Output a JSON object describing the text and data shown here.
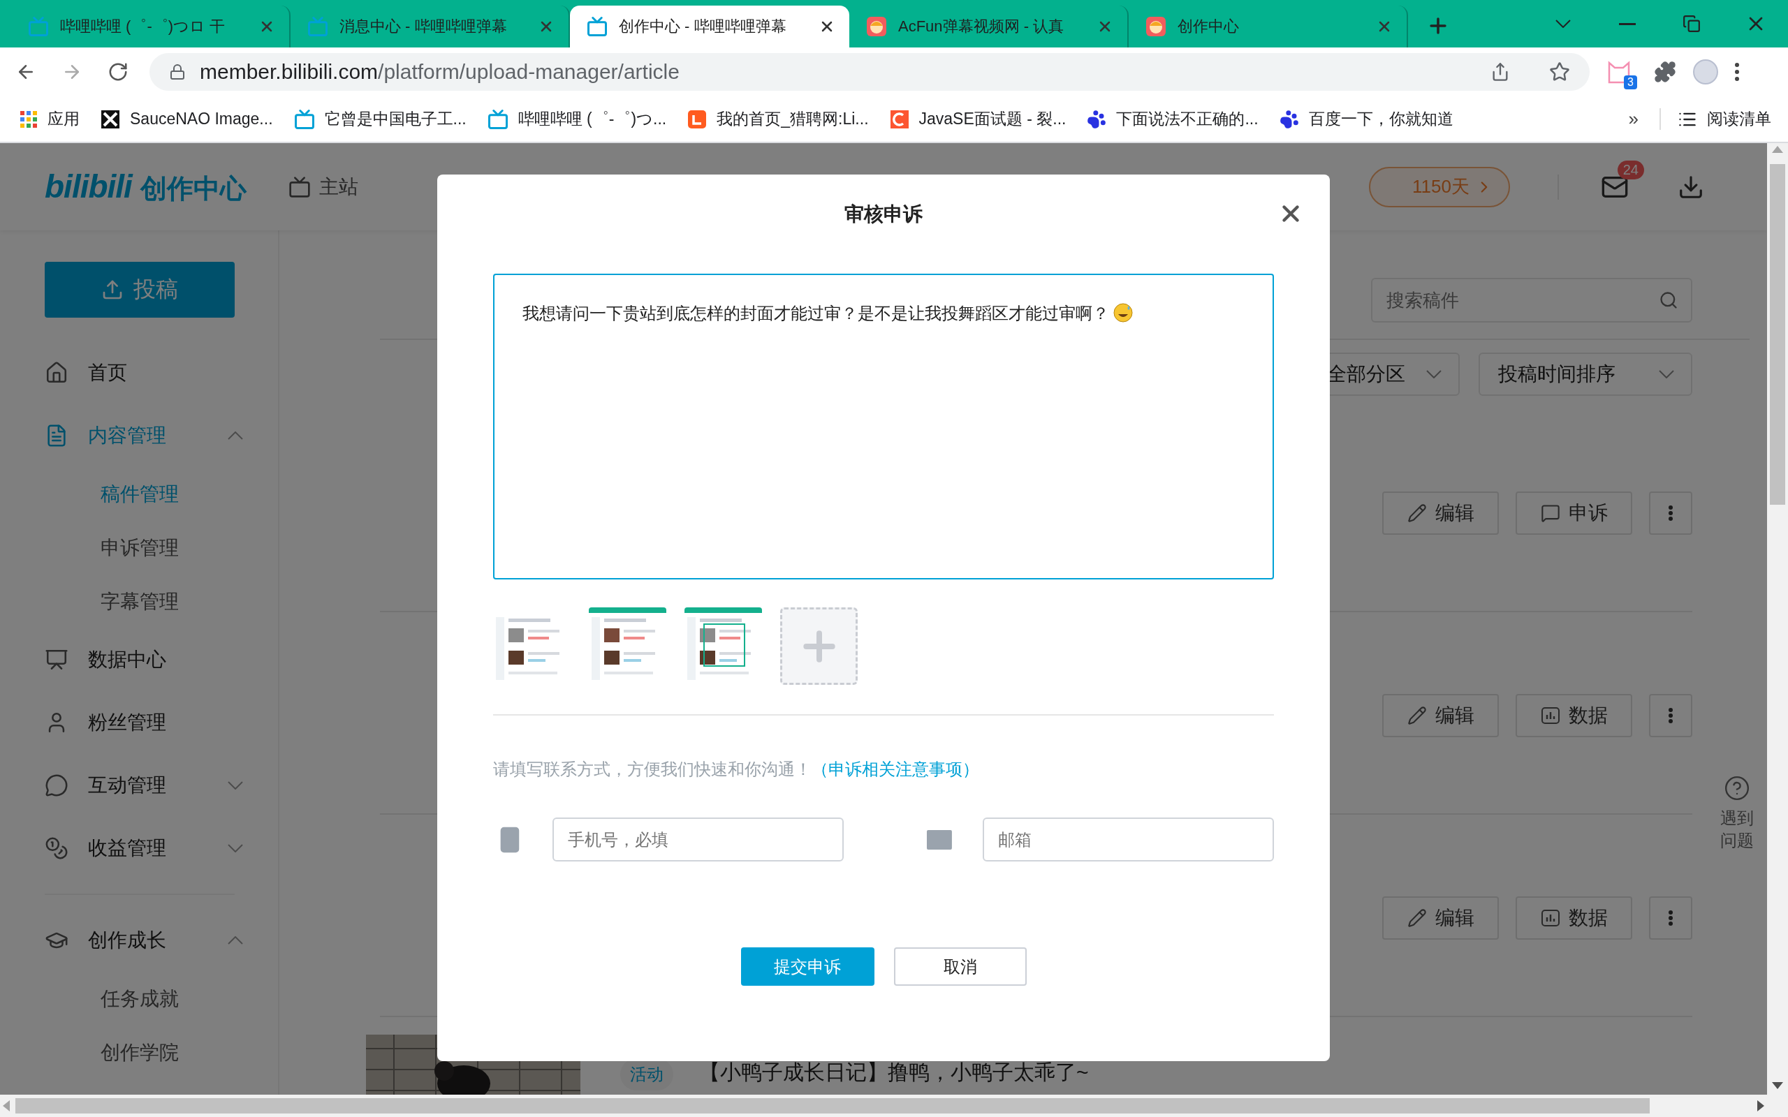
{
  "browser": {
    "tabs": [
      {
        "kind": "bili",
        "title": "哔哩哔哩 (゜-゜)つロ 干",
        "selected": false
      },
      {
        "kind": "bili",
        "title": "消息中心 - 哔哩哔哩弹幕",
        "selected": false
      },
      {
        "kind": "bili",
        "title": "创作中心 - 哔哩哔哩弹幕",
        "selected": true
      },
      {
        "kind": "acfun",
        "title": "AcFun弹幕视频网 - 认真",
        "selected": false
      },
      {
        "kind": "acfun",
        "title": "创作中心",
        "selected": false
      }
    ],
    "address": {
      "host": "member.bilibili.com",
      "path": "/platform/upload-manager/article"
    },
    "extension_badge": "3",
    "bookmarks": [
      {
        "kind": "apps",
        "label": "应用"
      },
      {
        "kind": "sauce",
        "label": "SauceNAO Image..."
      },
      {
        "kind": "bili",
        "label": "它曾是中国电子工..."
      },
      {
        "kind": "bili",
        "label": "哔哩哔哩 (゜-゜)つ..."
      },
      {
        "kind": "liepin",
        "label": "我的首页_猎聘网:Li..."
      },
      {
        "kind": "csdn",
        "label": "JavaSE面试题 - 裂..."
      },
      {
        "kind": "baidu",
        "label": "下面说法不正确的..."
      },
      {
        "kind": "baidu",
        "label": "百度一下，你就知道"
      }
    ],
    "overflow": "»",
    "reading_list": "阅读清单"
  },
  "header": {
    "logo": "bilibili",
    "logo_title": "创作中心",
    "main_site": "主站",
    "streak": "1150天",
    "mail_badge": "24"
  },
  "sidebar": {
    "upload": "投稿",
    "sections": [
      {
        "items": [
          {
            "kind": "home",
            "label": "首页",
            "selected": false
          },
          {
            "kind": "content",
            "label": "内容管理",
            "selected": true,
            "expanded": true,
            "children": [
              {
                "label": "稿件管理",
                "selected": true
              },
              {
                "label": "申诉管理",
                "selected": false
              },
              {
                "label": "字幕管理",
                "selected": false
              }
            ]
          },
          {
            "kind": "data",
            "label": "数据中心",
            "selected": false
          },
          {
            "kind": "fans",
            "label": "粉丝管理",
            "selected": false
          },
          {
            "kind": "interact",
            "label": "互动管理",
            "selected": false,
            "expanded": false
          },
          {
            "kind": "income",
            "label": "收益管理",
            "selected": false,
            "expanded": false
          }
        ]
      },
      {
        "items": [
          {
            "kind": "growth",
            "label": "创作成长",
            "selected": false,
            "expanded": true,
            "children": [
              {
                "label": "任务成就",
                "selected": false
              },
              {
                "label": "创作学院",
                "selected": false
              }
            ]
          }
        ]
      }
    ]
  },
  "content": {
    "search": {
      "placeholder": "搜索稿件"
    },
    "filters": [
      "全部分区",
      "投稿时间排序"
    ],
    "rows": [
      {
        "actions": [
          {
            "kind": "edit",
            "label": "编辑"
          },
          {
            "kind": "appeal",
            "label": "申诉"
          }
        ]
      },
      {
        "actions": [
          {
            "kind": "edit",
            "label": "编辑"
          },
          {
            "kind": "data",
            "label": "数据"
          }
        ]
      },
      {
        "actions": [
          {
            "kind": "edit",
            "label": "编辑"
          },
          {
            "kind": "data",
            "label": "数据"
          }
        ]
      }
    ],
    "last_row": {
      "tag": "活动",
      "title": "【小鸭子成长日记】撸鸭，小鸭子太乖了~"
    },
    "help": "遇到问题"
  },
  "modal": {
    "title": "审核申诉",
    "text": "我想请问一下贵站到底怎样的封面才能过审？是不是让我投舞蹈区才能过审啊？",
    "contact_prompt": "请填写联系方式，方便我们快速和你沟通！",
    "contact_link": "（申诉相关注意事项）",
    "phone_placeholder": "手机号，必填",
    "email_placeholder": "邮箱",
    "submit": "提交申诉",
    "cancel": "取消"
  }
}
